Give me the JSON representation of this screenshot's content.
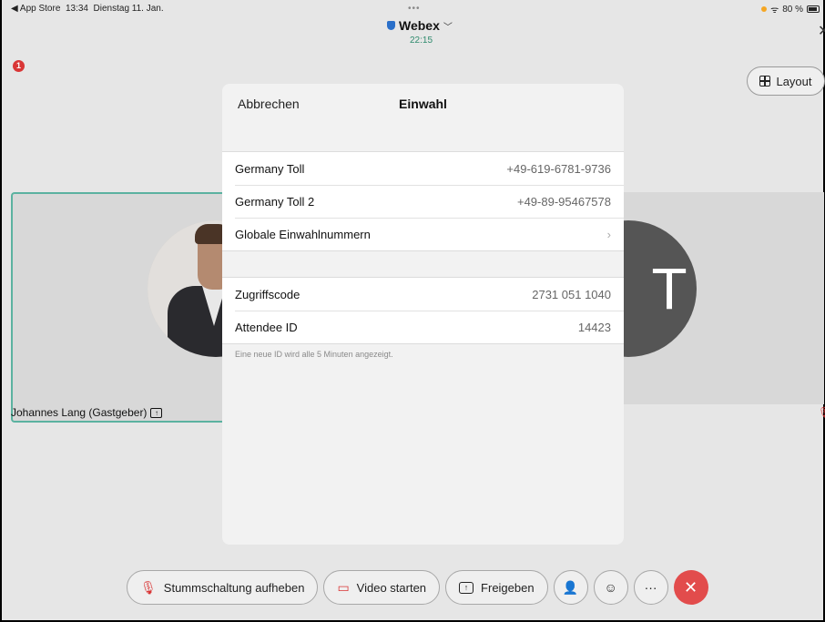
{
  "status_bar": {
    "back_app": "◀ App Store",
    "time": "13:34",
    "date": "Dienstag 11. Jan.",
    "battery": "80 %"
  },
  "header": {
    "app_title": "Webex",
    "timer": "22:15",
    "notification_count": "1",
    "layout_label": "Layout"
  },
  "participant": {
    "name": "Johannes Lang (Gastgeber)",
    "initials": "T"
  },
  "dialog": {
    "cancel_label": "Abbrechen",
    "title": "Einwahl",
    "numbers": [
      {
        "label": "Germany Toll",
        "value": "+49-619-6781-9736"
      },
      {
        "label": "Germany Toll 2",
        "value": "+49-89-95467578"
      },
      {
        "label": "Globale Einwahlnummern",
        "value": "›"
      }
    ],
    "access": [
      {
        "label": "Zugriffscode",
        "value": "2731 051 1040"
      },
      {
        "label": "Attendee ID",
        "value": "14423"
      }
    ],
    "footnote": "Eine neue ID wird alle 5 Minuten angezeigt."
  },
  "controls": {
    "unmute_label": "Stummschaltung aufheben",
    "video_label": "Video starten",
    "share_label": "Freigeben"
  },
  "colors": {
    "end_call": "#e24c4c",
    "accent_green": "#2f8b6d",
    "badge_red": "#d93636"
  }
}
